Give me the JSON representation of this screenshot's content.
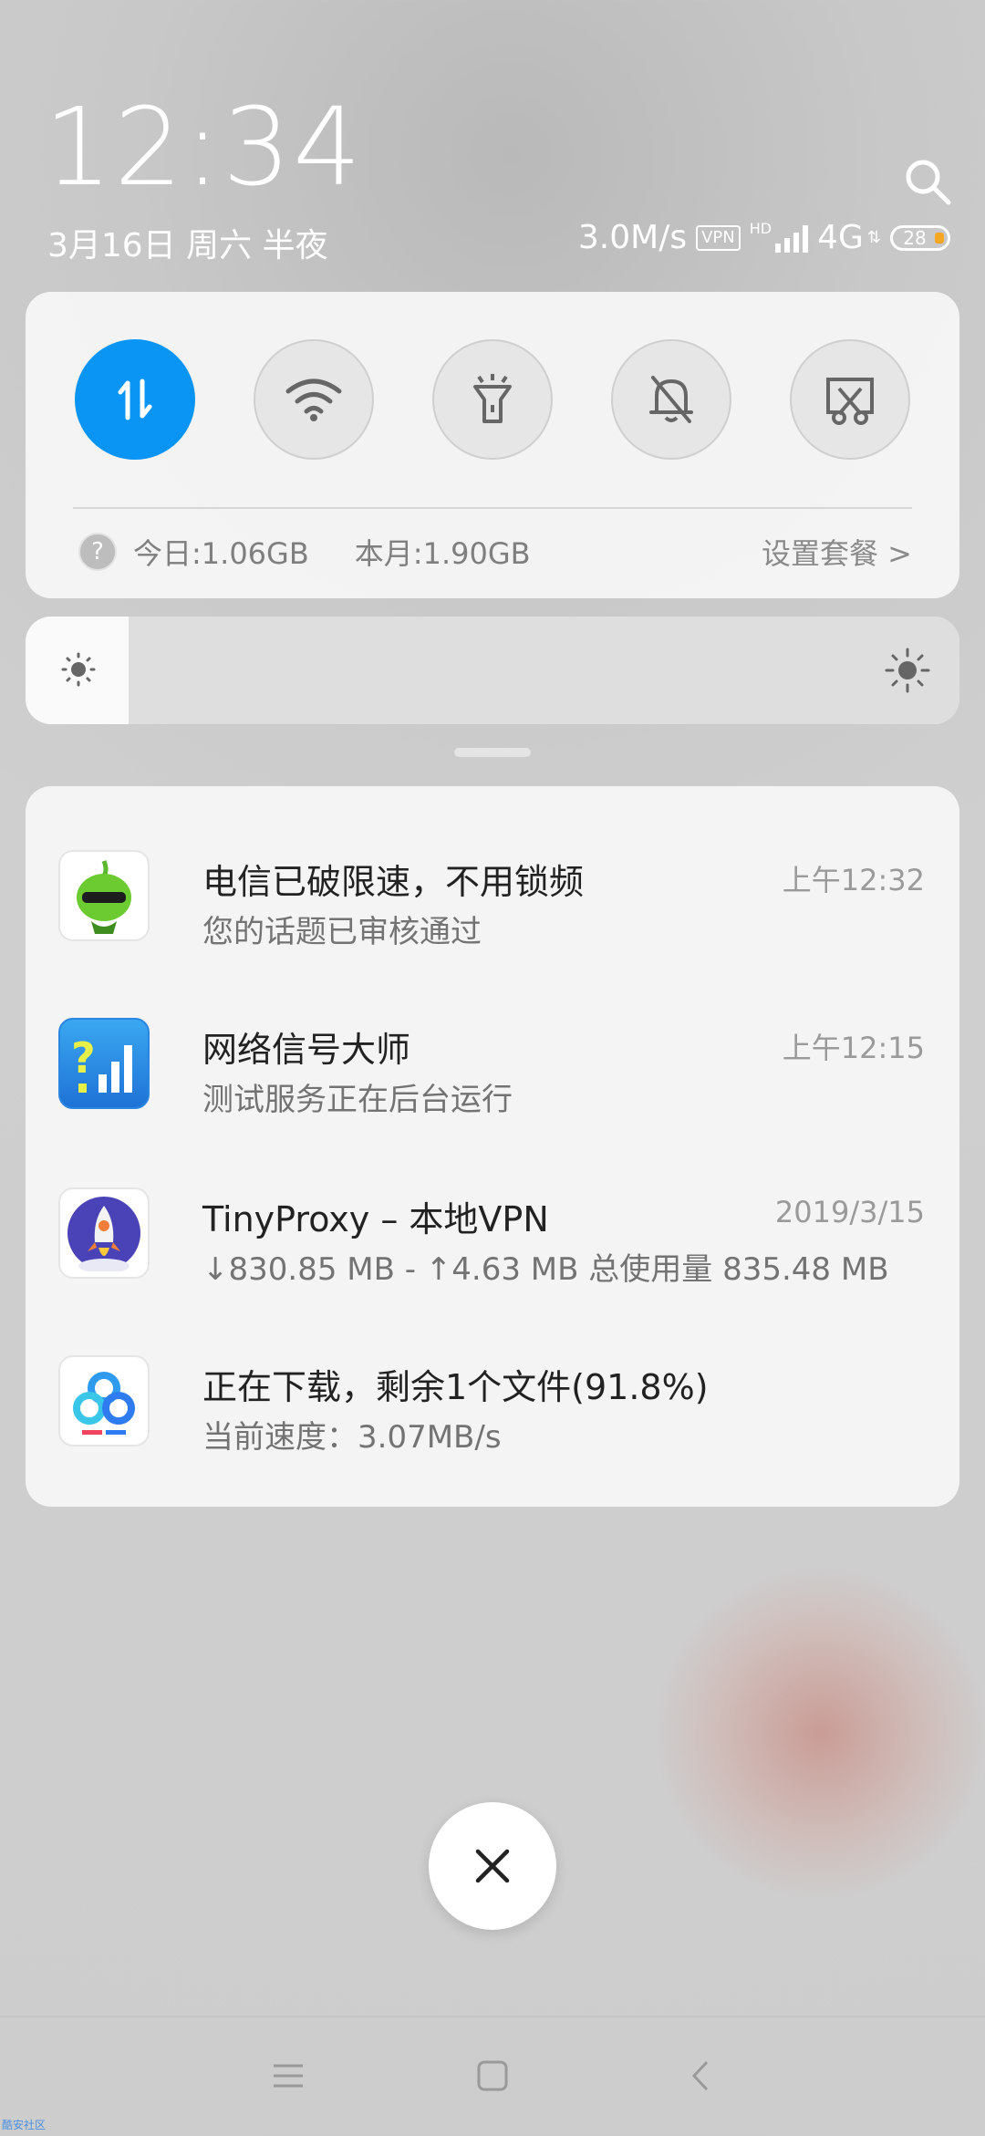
{
  "status_bar": {
    "time": "12:34",
    "date": "3月16日 周六 半夜",
    "net_speed": "3.0M/s",
    "vpn_label": "VPN",
    "hd_label": "HD",
    "network_type": "4G",
    "battery_level": "28"
  },
  "quick_toggles": {
    "items": [
      {
        "name": "mobile-data",
        "active": true
      },
      {
        "name": "wifi",
        "active": false
      },
      {
        "name": "flashlight",
        "active": false
      },
      {
        "name": "silent",
        "active": false
      },
      {
        "name": "screenshot",
        "active": false
      }
    ],
    "data_usage": {
      "today": "今日:1.06GB",
      "month": "本月:1.90GB",
      "plan_link": "设置套餐 >"
    },
    "accent_color": "#0a95f5"
  },
  "brightness": {
    "level": 0.11
  },
  "notifications": [
    {
      "app_icon": "green-alien-icon",
      "title": "电信已破限速，不用锁频",
      "text": "您的话题已审核通过",
      "time": "上午12:32"
    },
    {
      "app_icon": "signal-master-icon",
      "title": "网络信号大师",
      "text": "测试服务正在后台运行",
      "time": "上午12:15"
    },
    {
      "app_icon": "rocket-icon",
      "title": "TinyProxy – 本地VPN",
      "text": "↓830.85 MB - ↑4.63 MB 总使用量 835.48 MB",
      "time": "2019/3/15"
    },
    {
      "app_icon": "baidu-cloud-icon",
      "title": "正在下载，剩余1个文件(91.8%)",
      "text": "当前速度：3.07MB/s",
      "time": ""
    }
  ],
  "watermark": "酷安社区"
}
